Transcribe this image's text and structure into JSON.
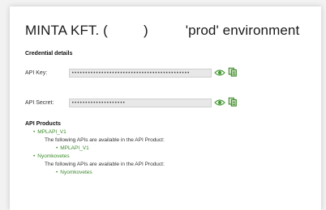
{
  "header": {
    "org_name": "MINTA KFT. (",
    "paren_close": ")",
    "env_label": "'prod' environment"
  },
  "credentials": {
    "heading": "Credential details",
    "api_key_label": "API Key:",
    "api_key_value": "••••••••••••••••••••••••••••••••••••••••••••",
    "api_secret_label": "API Secret:",
    "api_secret_value": "••••••••••••••••••••"
  },
  "products": {
    "heading": "API Products",
    "items": [
      {
        "name": "MPLAPI_V1",
        "description": "The following APIs are available in the API Product:",
        "apis": [
          "MPLAPI_V1"
        ]
      },
      {
        "name": "Nyomkovetes",
        "description": "The following APIs are available in the API Product:",
        "apis": [
          "Nyomkovetes"
        ]
      }
    ]
  },
  "colors": {
    "accent_green": "#3a8a2a",
    "field_bg": "#e8e8e8"
  },
  "icons": {
    "show": "eye-icon",
    "copy": "copy-icon"
  }
}
